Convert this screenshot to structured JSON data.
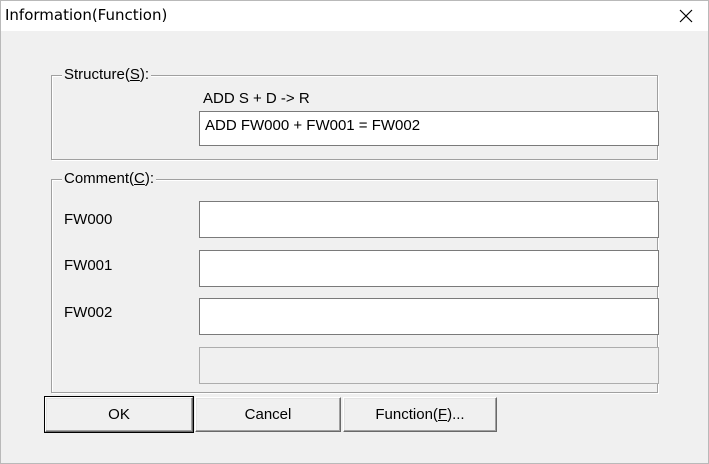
{
  "window": {
    "title": "Information(Function)",
    "close_icon": "close-icon"
  },
  "structure": {
    "label_prefix": "Structure(",
    "label_hotkey": "S",
    "label_suffix": "):",
    "syntax": "ADD S + D -> R",
    "expression": "ADD FW000 + FW001 = FW002"
  },
  "comment": {
    "label_prefix": "Comment(",
    "label_hotkey": "C",
    "label_suffix": "):",
    "rows": [
      {
        "label": "FW000",
        "value": ""
      },
      {
        "label": "FW001",
        "value": ""
      },
      {
        "label": "FW002",
        "value": ""
      },
      {
        "label": "",
        "value": ""
      }
    ]
  },
  "buttons": {
    "ok": "OK",
    "cancel": "Cancel",
    "function_prefix": "Function(",
    "function_hotkey": "F",
    "function_suffix": ")..."
  }
}
